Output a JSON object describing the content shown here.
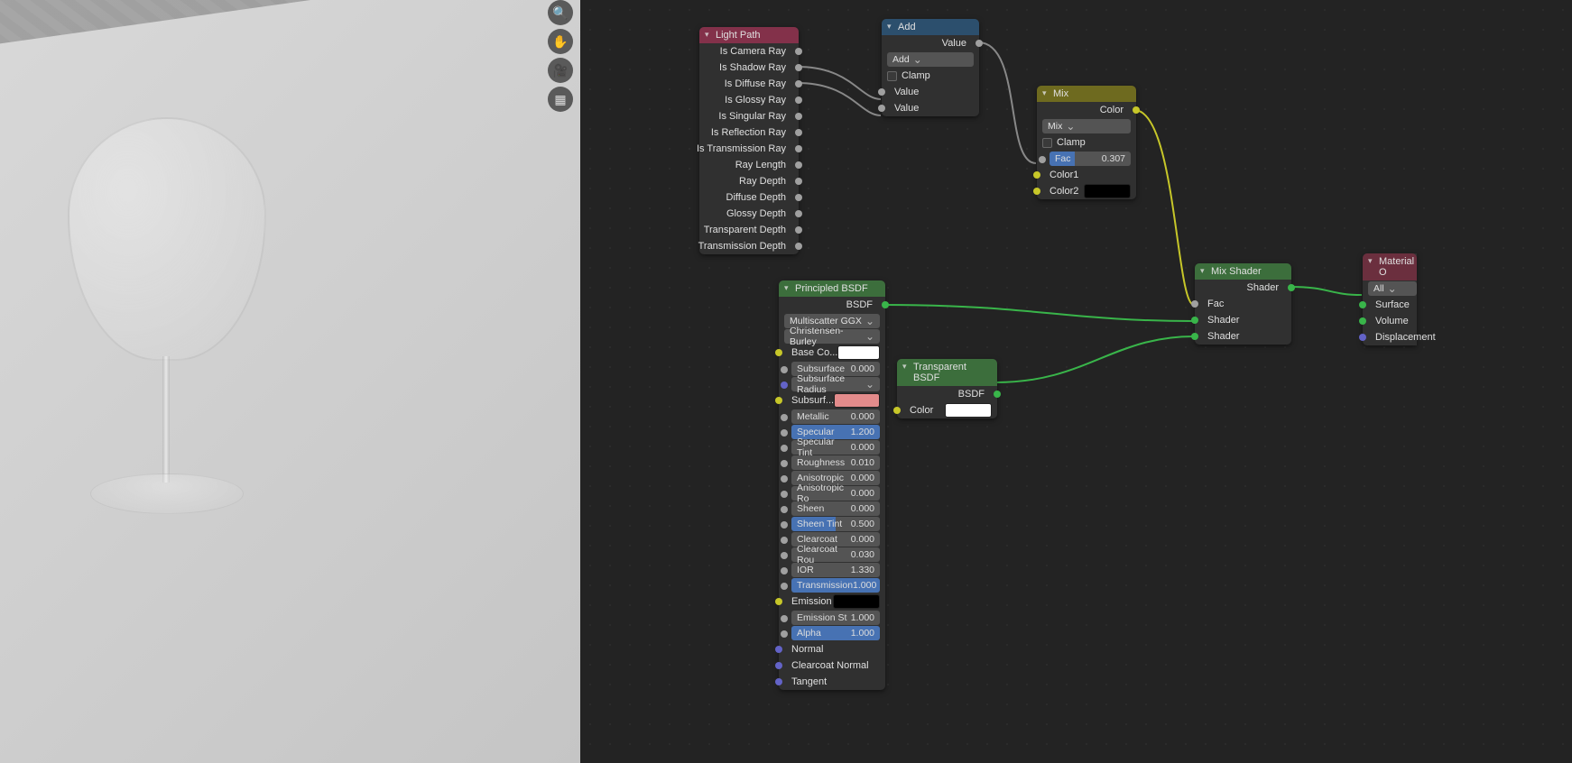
{
  "viewport": {
    "buttons": [
      "zoom",
      "hand",
      "camera",
      "grid"
    ]
  },
  "nodes": {
    "lightpath": {
      "title": "Light Path",
      "outputs": [
        "Is Camera Ray",
        "Is Shadow Ray",
        "Is Diffuse Ray",
        "Is Glossy Ray",
        "Is Singular Ray",
        "Is Reflection Ray",
        "Is Transmission Ray",
        "Ray Length",
        "Ray Depth",
        "Diffuse Depth",
        "Glossy Depth",
        "Transparent Depth",
        "Transmission Depth"
      ]
    },
    "add": {
      "title": "Add",
      "out": "Value",
      "mode": "Add",
      "clamp": "Clamp",
      "in1": "Value",
      "in2": "Value"
    },
    "mix": {
      "title": "Mix",
      "out": "Color",
      "mode": "Mix",
      "clamp": "Clamp",
      "fac_lbl": "Fac",
      "fac_val": "0.307",
      "c1": "Color1",
      "c2": "Color2"
    },
    "principled": {
      "title": "Principled BSDF",
      "out": "BSDF",
      "dist": "Multiscatter GGX",
      "sss": "Christensen-Burley",
      "base": "Base Co...",
      "rows": [
        {
          "lbl": "Subsurface",
          "val": "0.000",
          "blue": false
        },
        {
          "lbl": "Subsurface Radius",
          "val": "",
          "dd": true
        },
        {
          "lbl": "Subsurf...",
          "val": "",
          "swatch": "red"
        },
        {
          "lbl": "Metallic",
          "val": "0.000",
          "blue": false
        },
        {
          "lbl": "Specular",
          "val": "1.200",
          "blue": true,
          "p": 100
        },
        {
          "lbl": "Specular Tint",
          "val": "0.000",
          "blue": false
        },
        {
          "lbl": "Roughness",
          "val": "0.010",
          "blue": false
        },
        {
          "lbl": "Anisotropic",
          "val": "0.000",
          "blue": false
        },
        {
          "lbl": "Anisotropic Ro",
          "val": "0.000",
          "blue": false
        },
        {
          "lbl": "Sheen",
          "val": "0.000",
          "blue": false
        },
        {
          "lbl": "Sheen Tint",
          "val": "0.500",
          "blue": true,
          "p": 50
        },
        {
          "lbl": "Clearcoat",
          "val": "0.000",
          "blue": false
        },
        {
          "lbl": "Clearcoat Rou",
          "val": "0.030",
          "blue": false
        },
        {
          "lbl": "IOR",
          "val": "1.330",
          "blue": false
        },
        {
          "lbl": "Transmission",
          "val": "1.000",
          "blue": true,
          "p": 100
        }
      ],
      "emission": "Emission",
      "emstr_lbl": "Emission St",
      "emstr_val": "1.000",
      "alpha_lbl": "Alpha",
      "alpha_val": "1.000",
      "normal": "Normal",
      "cnormal": "Clearcoat Normal",
      "tangent": "Tangent"
    },
    "transparent": {
      "title": "Transparent BSDF",
      "out": "BSDF",
      "color": "Color"
    },
    "mixshader": {
      "title": "Mix Shader",
      "out": "Shader",
      "fac": "Fac",
      "s1": "Shader",
      "s2": "Shader"
    },
    "matout": {
      "title": "Material O",
      "target": "All",
      "surface": "Surface",
      "volume": "Volume",
      "disp": "Displacement"
    }
  }
}
